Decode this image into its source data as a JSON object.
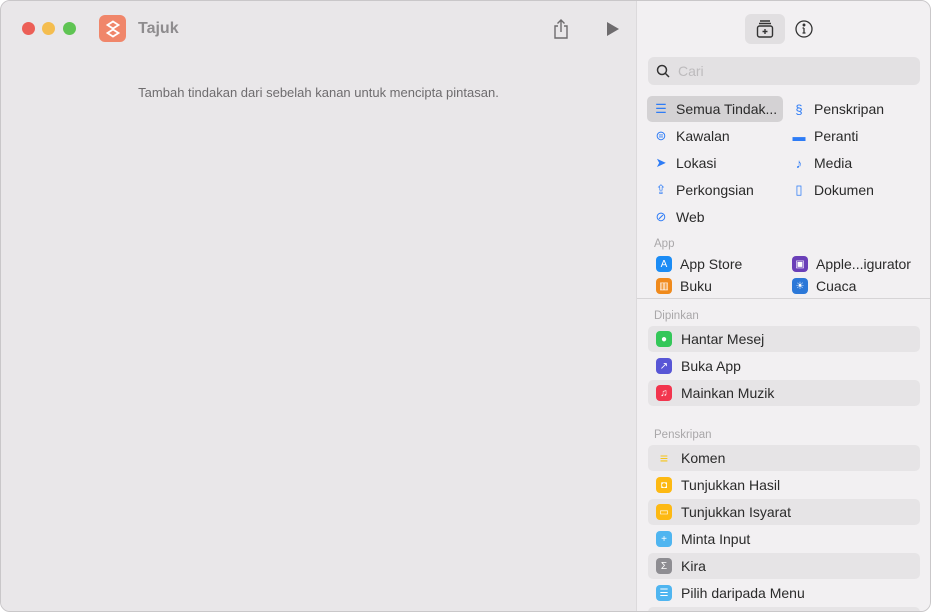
{
  "window": {
    "title": "Tajuk",
    "hint": "Tambah tindakan dari sebelah kanan untuk mencipta pintasan."
  },
  "sidebar": {
    "search_placeholder": "Cari",
    "categories": [
      {
        "label": "Semua Tindak...",
        "icon": "list-icon"
      },
      {
        "label": "Penskripan",
        "icon": "scripting-icon"
      },
      {
        "label": "Kawalan",
        "icon": "toggle-icon"
      },
      {
        "label": "Peranti",
        "icon": "display-icon"
      },
      {
        "label": "Lokasi",
        "icon": "location-arrow-icon"
      },
      {
        "label": "Media",
        "icon": "music-note-icon"
      },
      {
        "label": "Perkongsian",
        "icon": "share-icon"
      },
      {
        "label": "Dokumen",
        "icon": "document-icon"
      },
      {
        "label": "Web",
        "icon": "compass-icon"
      }
    ],
    "apps_header": "App",
    "apps": [
      {
        "label": "App Store",
        "color": "#1b8cf5"
      },
      {
        "label": "Apple...igurator",
        "color": "#6a3fb8"
      },
      {
        "label": "Buku",
        "color": "#f08a1c"
      },
      {
        "label": "Cuaca",
        "color": "#2c78d8"
      }
    ],
    "pinned_header": "Dipinkan",
    "pinned": [
      {
        "label": "Hantar Mesej",
        "color": "#34c759",
        "glyph": "●"
      },
      {
        "label": "Buka App",
        "color": "#5856d6",
        "glyph": "↗"
      },
      {
        "label": "Mainkan Muzik",
        "color": "#f2354e",
        "glyph": "♫"
      }
    ],
    "scripting_header": "Penskripan",
    "scripting": [
      {
        "label": "Komen",
        "color": "transparent",
        "glyph": "≡"
      },
      {
        "label": "Tunjukkan Hasil",
        "color": "#fdb913",
        "glyph": "◘"
      },
      {
        "label": "Tunjukkan Isyarat",
        "color": "#fdb913",
        "glyph": "▭"
      },
      {
        "label": "Minta Input",
        "color": "#4fb5f0",
        "glyph": "+"
      },
      {
        "label": "Kira",
        "color": "#8e8d92",
        "glyph": "Σ"
      },
      {
        "label": "Pilih daripada Menu",
        "color": "#4fb5f0",
        "glyph": "☰"
      }
    ]
  }
}
